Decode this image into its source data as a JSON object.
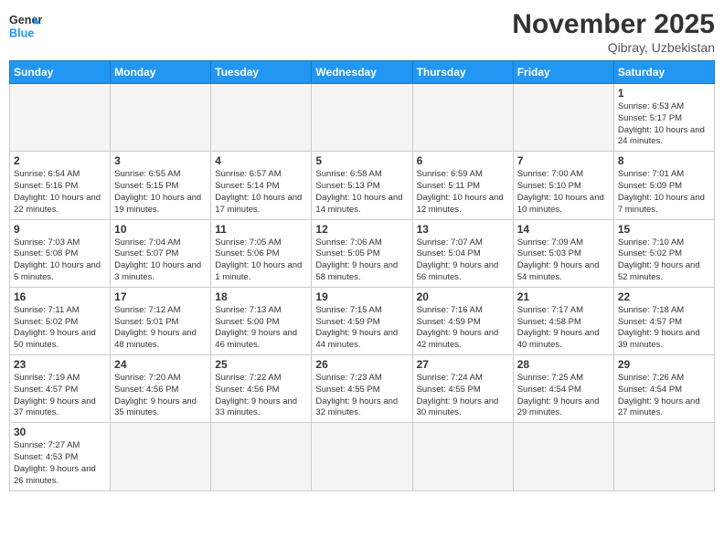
{
  "header": {
    "logo_general": "General",
    "logo_blue": "Blue",
    "month_title": "November 2025",
    "location": "Qibray, Uzbekistan"
  },
  "weekdays": [
    "Sunday",
    "Monday",
    "Tuesday",
    "Wednesday",
    "Thursday",
    "Friday",
    "Saturday"
  ],
  "days": {
    "1": {
      "sunrise": "6:53 AM",
      "sunset": "5:17 PM",
      "daylight": "10 hours and 24 minutes."
    },
    "2": {
      "sunrise": "6:54 AM",
      "sunset": "5:16 PM",
      "daylight": "10 hours and 22 minutes."
    },
    "3": {
      "sunrise": "6:55 AM",
      "sunset": "5:15 PM",
      "daylight": "10 hours and 19 minutes."
    },
    "4": {
      "sunrise": "6:57 AM",
      "sunset": "5:14 PM",
      "daylight": "10 hours and 17 minutes."
    },
    "5": {
      "sunrise": "6:58 AM",
      "sunset": "5:13 PM",
      "daylight": "10 hours and 14 minutes."
    },
    "6": {
      "sunrise": "6:59 AM",
      "sunset": "5:11 PM",
      "daylight": "10 hours and 12 minutes."
    },
    "7": {
      "sunrise": "7:00 AM",
      "sunset": "5:10 PM",
      "daylight": "10 hours and 10 minutes."
    },
    "8": {
      "sunrise": "7:01 AM",
      "sunset": "5:09 PM",
      "daylight": "10 hours and 7 minutes."
    },
    "9": {
      "sunrise": "7:03 AM",
      "sunset": "5:08 PM",
      "daylight": "10 hours and 5 minutes."
    },
    "10": {
      "sunrise": "7:04 AM",
      "sunset": "5:07 PM",
      "daylight": "10 hours and 3 minutes."
    },
    "11": {
      "sunrise": "7:05 AM",
      "sunset": "5:06 PM",
      "daylight": "10 hours and 1 minute."
    },
    "12": {
      "sunrise": "7:06 AM",
      "sunset": "5:05 PM",
      "daylight": "9 hours and 58 minutes."
    },
    "13": {
      "sunrise": "7:07 AM",
      "sunset": "5:04 PM",
      "daylight": "9 hours and 56 minutes."
    },
    "14": {
      "sunrise": "7:09 AM",
      "sunset": "5:03 PM",
      "daylight": "9 hours and 54 minutes."
    },
    "15": {
      "sunrise": "7:10 AM",
      "sunset": "5:02 PM",
      "daylight": "9 hours and 52 minutes."
    },
    "16": {
      "sunrise": "7:11 AM",
      "sunset": "5:02 PM",
      "daylight": "9 hours and 50 minutes."
    },
    "17": {
      "sunrise": "7:12 AM",
      "sunset": "5:01 PM",
      "daylight": "9 hours and 48 minutes."
    },
    "18": {
      "sunrise": "7:13 AM",
      "sunset": "5:00 PM",
      "daylight": "9 hours and 46 minutes."
    },
    "19": {
      "sunrise": "7:15 AM",
      "sunset": "4:59 PM",
      "daylight": "9 hours and 44 minutes."
    },
    "20": {
      "sunrise": "7:16 AM",
      "sunset": "4:59 PM",
      "daylight": "9 hours and 42 minutes."
    },
    "21": {
      "sunrise": "7:17 AM",
      "sunset": "4:58 PM",
      "daylight": "9 hours and 40 minutes."
    },
    "22": {
      "sunrise": "7:18 AM",
      "sunset": "4:57 PM",
      "daylight": "9 hours and 39 minutes."
    },
    "23": {
      "sunrise": "7:19 AM",
      "sunset": "4:57 PM",
      "daylight": "9 hours and 37 minutes."
    },
    "24": {
      "sunrise": "7:20 AM",
      "sunset": "4:56 PM",
      "daylight": "9 hours and 35 minutes."
    },
    "25": {
      "sunrise": "7:22 AM",
      "sunset": "4:56 PM",
      "daylight": "9 hours and 33 minutes."
    },
    "26": {
      "sunrise": "7:23 AM",
      "sunset": "4:55 PM",
      "daylight": "9 hours and 32 minutes."
    },
    "27": {
      "sunrise": "7:24 AM",
      "sunset": "4:55 PM",
      "daylight": "9 hours and 30 minutes."
    },
    "28": {
      "sunrise": "7:25 AM",
      "sunset": "4:54 PM",
      "daylight": "9 hours and 29 minutes."
    },
    "29": {
      "sunrise": "7:26 AM",
      "sunset": "4:54 PM",
      "daylight": "9 hours and 27 minutes."
    },
    "30": {
      "sunrise": "7:27 AM",
      "sunset": "4:53 PM",
      "daylight": "9 hours and 26 minutes."
    }
  }
}
